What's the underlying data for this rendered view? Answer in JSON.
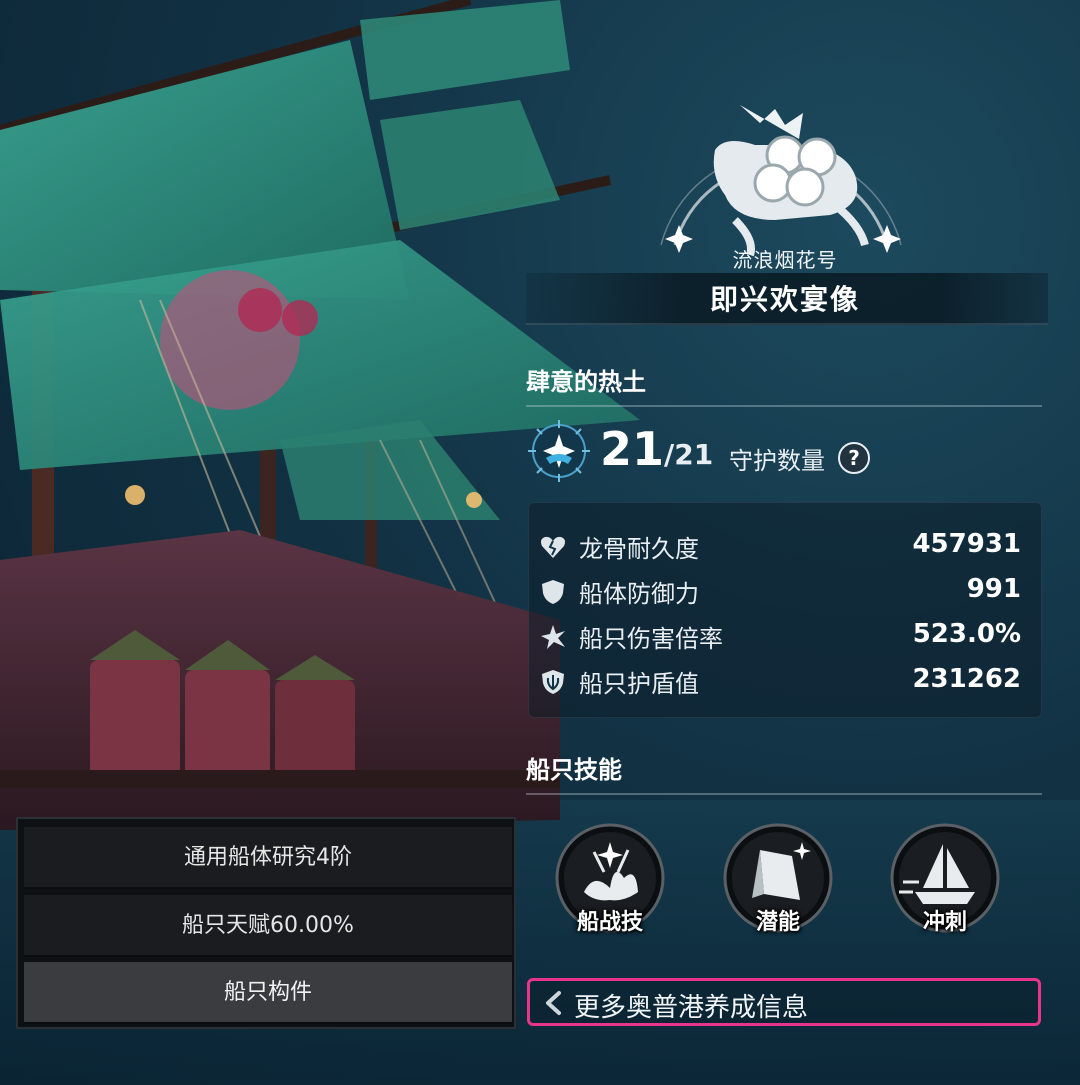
{
  "ship": {
    "name": "流浪烟花号",
    "title": "即兴欢宴像"
  },
  "guard_section": {
    "header": "肆意的热土",
    "current": "21",
    "max": "/21",
    "label": "守护数量",
    "help_icon": "question-icon"
  },
  "stats": [
    {
      "icon": "broken-heart-icon",
      "label": "龙骨耐久度",
      "value": "457931"
    },
    {
      "icon": "shield-icon",
      "label": "船体防御力",
      "value": "991"
    },
    {
      "icon": "burst-icon",
      "label": "船只伤害倍率",
      "value": "523.0%"
    },
    {
      "icon": "guard-shield-icon",
      "label": "船只护盾值",
      "value": "231262"
    }
  ],
  "skills_section": {
    "header": "船只技能",
    "items": [
      {
        "label": "船战技",
        "icon": "fireworks-ship-icon"
      },
      {
        "label": "潜能",
        "icon": "sail-burst-icon"
      },
      {
        "label": "冲刺",
        "icon": "ship-dash-icon"
      }
    ]
  },
  "more_info": {
    "label": "更多奥普港养成信息",
    "icon": "chevron-left-icon"
  },
  "left_menu": [
    {
      "label": "通用船体研究4阶"
    },
    {
      "label": "船只天赋60.00%"
    },
    {
      "label": "船只构件"
    }
  ],
  "colors": {
    "highlight_border": "#e8348a",
    "sail_green": "#2f8a7a",
    "hull_red": "#7a2c3c"
  }
}
